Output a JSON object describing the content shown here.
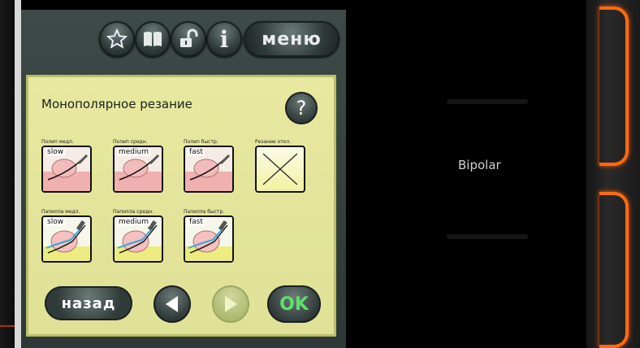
{
  "top_bar": {
    "info_label": "i",
    "menu_label": "меню"
  },
  "dialog": {
    "title": "Монополярное резание",
    "help_label": "?",
    "options": [
      {
        "label": "Полип медл.",
        "speed": "slow"
      },
      {
        "label": "Полип средн.",
        "speed": "medium"
      },
      {
        "label": "Полип быстр.",
        "speed": "fast"
      },
      {
        "label": "Резание откл.",
        "speed": ""
      },
      {
        "label": "Папилла медл.",
        "speed": "slow"
      },
      {
        "label": "Папилла средн.",
        "speed": "medium"
      },
      {
        "label": "Папилла быстр.",
        "speed": "fast"
      }
    ],
    "back_label": "назад",
    "ok_label": "OK"
  },
  "right_panel": {
    "mode_label": "Bipolar"
  },
  "colors": {
    "accent_orange": "#ff6a10",
    "dialog_yellow": "#e8e8a0",
    "ok_green": "#5ee06c"
  }
}
